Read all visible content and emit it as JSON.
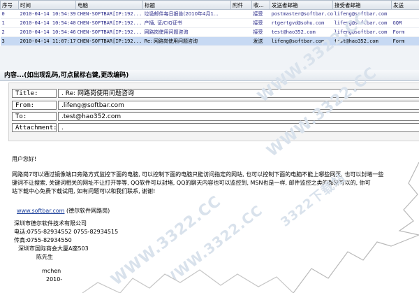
{
  "grid": {
    "headers": [
      "序号",
      "时间",
      "电脑",
      "标题",
      "附件",
      "收...",
      "发送者邮箱",
      "接受者邮箱",
      "发送"
    ],
    "rows": [
      {
        "no": "0",
        "time": "2010-04-14 10:54:39",
        "pc": "CHEN-SOFTBAR[IP:192...",
        "subject": "垃圾邮件每日报告(2010年4月1...",
        "attach": "",
        "dir": "接受",
        "from": "postmaster@softbar.com",
        "to": "lifeng@softbar.com",
        "extra": ""
      },
      {
        "no": "1",
        "time": "2010-04-14 10:54:40",
        "pc": "CHEN-SOFTBAR[IP:192...",
        "subject": "产插, 证/CIQ证书",
        "attach": "",
        "dir": "接受",
        "from": "rtgertgvd@sohu.com",
        "to": "lifeng@softbar.com",
        "extra": "GQM"
      },
      {
        "no": "2",
        "time": "2010-04-14 10:54:46",
        "pc": "CHEN-SOFTBAR[IP:192...",
        "subject": "网路岗使用问题咨询",
        "attach": "",
        "dir": "接受",
        "from": "test@hao352.com",
        "to": "lifeng@softbar.com",
        "extra": "Form"
      },
      {
        "no": "3",
        "time": "2010-04-14 11:07:17",
        "pc": "CHEN-SOFTBAR[IP:192...",
        "subject": "Re: 网路岗使用问题咨询",
        "attach": "",
        "dir": "发送",
        "from": "lifeng@softbar.com",
        "to": "test@hao352.com",
        "extra": "Form"
      }
    ]
  },
  "content_title": "内容...(如出现乱码,可点鼠标右键,更改编码)",
  "fields": [
    {
      "label": "Title:",
      "value": ". Re: 网路岗使用问题咨询"
    },
    {
      "label": "From:",
      "value": ".lifeng@softbar.com"
    },
    {
      "label": "To:",
      "value": ".test@hao352.com"
    },
    {
      "label": "Attachment:",
      "value": "."
    }
  ],
  "body": {
    "greeting": "用户您好!",
    "line1": "网路岗7可以通过镜像端口旁路方式监控下面的电脑, 可以控制下面的电脑只能访问指定的网站, 也可以控制下面的电脑不能上哪些网页, 也可以封堵一些",
    "line2": "键词不让搜索, 关键词相关的网址不让打开等等, QQ软件可以封堵, QQ的聊天内容也可以监控到, MSN也是一样, 邮件监控之类的都是可以的, 你可",
    "line3": "站下载中心免费下载试用, 如有问题可以和我们联系, 谢谢!",
    "site_link": "www.softbar.com",
    "site_name": "(德尔软件网路岗)",
    "company": "深圳市德尔软件技术有限公司",
    "tel": "电话:0755-82934552  0755-82934515",
    "fax": "传真:0755-82934550",
    "address": "深圳市国际商会大厦A座503",
    "contact": "陈先生",
    "sig_name": "mchen",
    "sig_date": "2010-"
  },
  "watermark": "WWW.3322.CC",
  "watermark_alt": "3322下载站"
}
